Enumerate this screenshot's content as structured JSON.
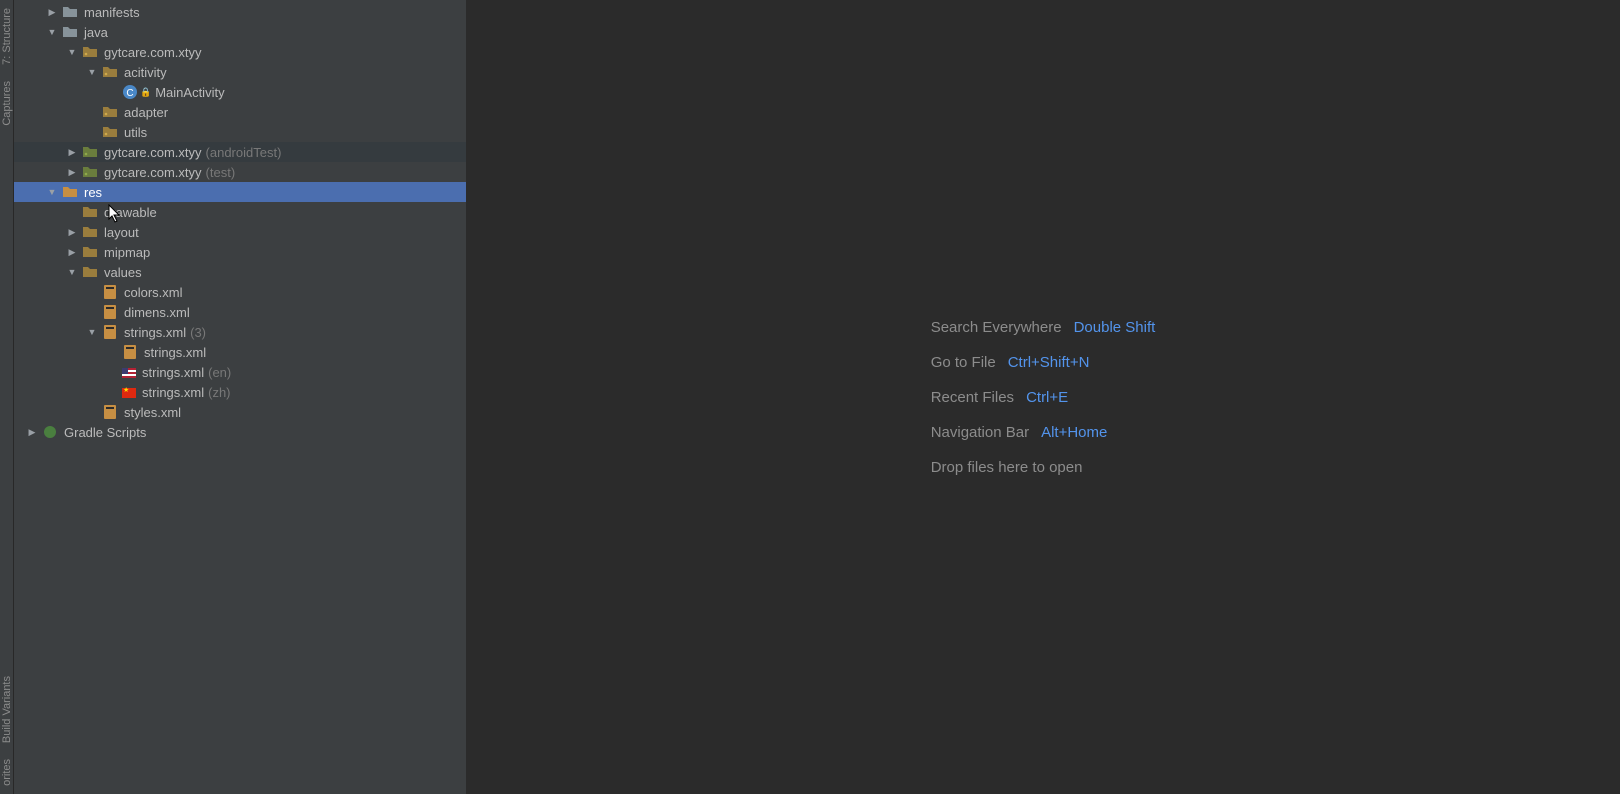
{
  "gutter": {
    "structure": "7: Structure",
    "captures": "Captures",
    "build_variants": "Build Variants",
    "favorites": "orites"
  },
  "tree": {
    "manifests": "manifests",
    "java": "java",
    "pkg_main": "gytcare.com.xtyy",
    "activity": "acitivity",
    "main_activity": "MainActivity",
    "adapter": "adapter",
    "utils": "utils",
    "pkg_androidtest_suffix": "(androidTest)",
    "pkg_test_suffix": "(test)",
    "res": "res",
    "drawable": "drawable",
    "layout": "layout",
    "mipmap": "mipmap",
    "values": "values",
    "colors_xml": "colors.xml",
    "dimens_xml": "dimens.xml",
    "strings_xml": "strings.xml",
    "strings_count": "(3)",
    "strings_en_suffix": "(en)",
    "strings_zh_suffix": "(zh)",
    "styles_xml": "styles.xml",
    "gradle_scripts": "Gradle Scripts"
  },
  "empty": {
    "search_label": "Search Everywhere",
    "search_shortcut": "Double Shift",
    "goto_label": "Go to File",
    "goto_shortcut": "Ctrl+Shift+N",
    "recent_label": "Recent Files",
    "recent_shortcut": "Ctrl+E",
    "nav_label": "Navigation Bar",
    "nav_shortcut": "Alt+Home",
    "drop_label": "Drop files here to open"
  }
}
